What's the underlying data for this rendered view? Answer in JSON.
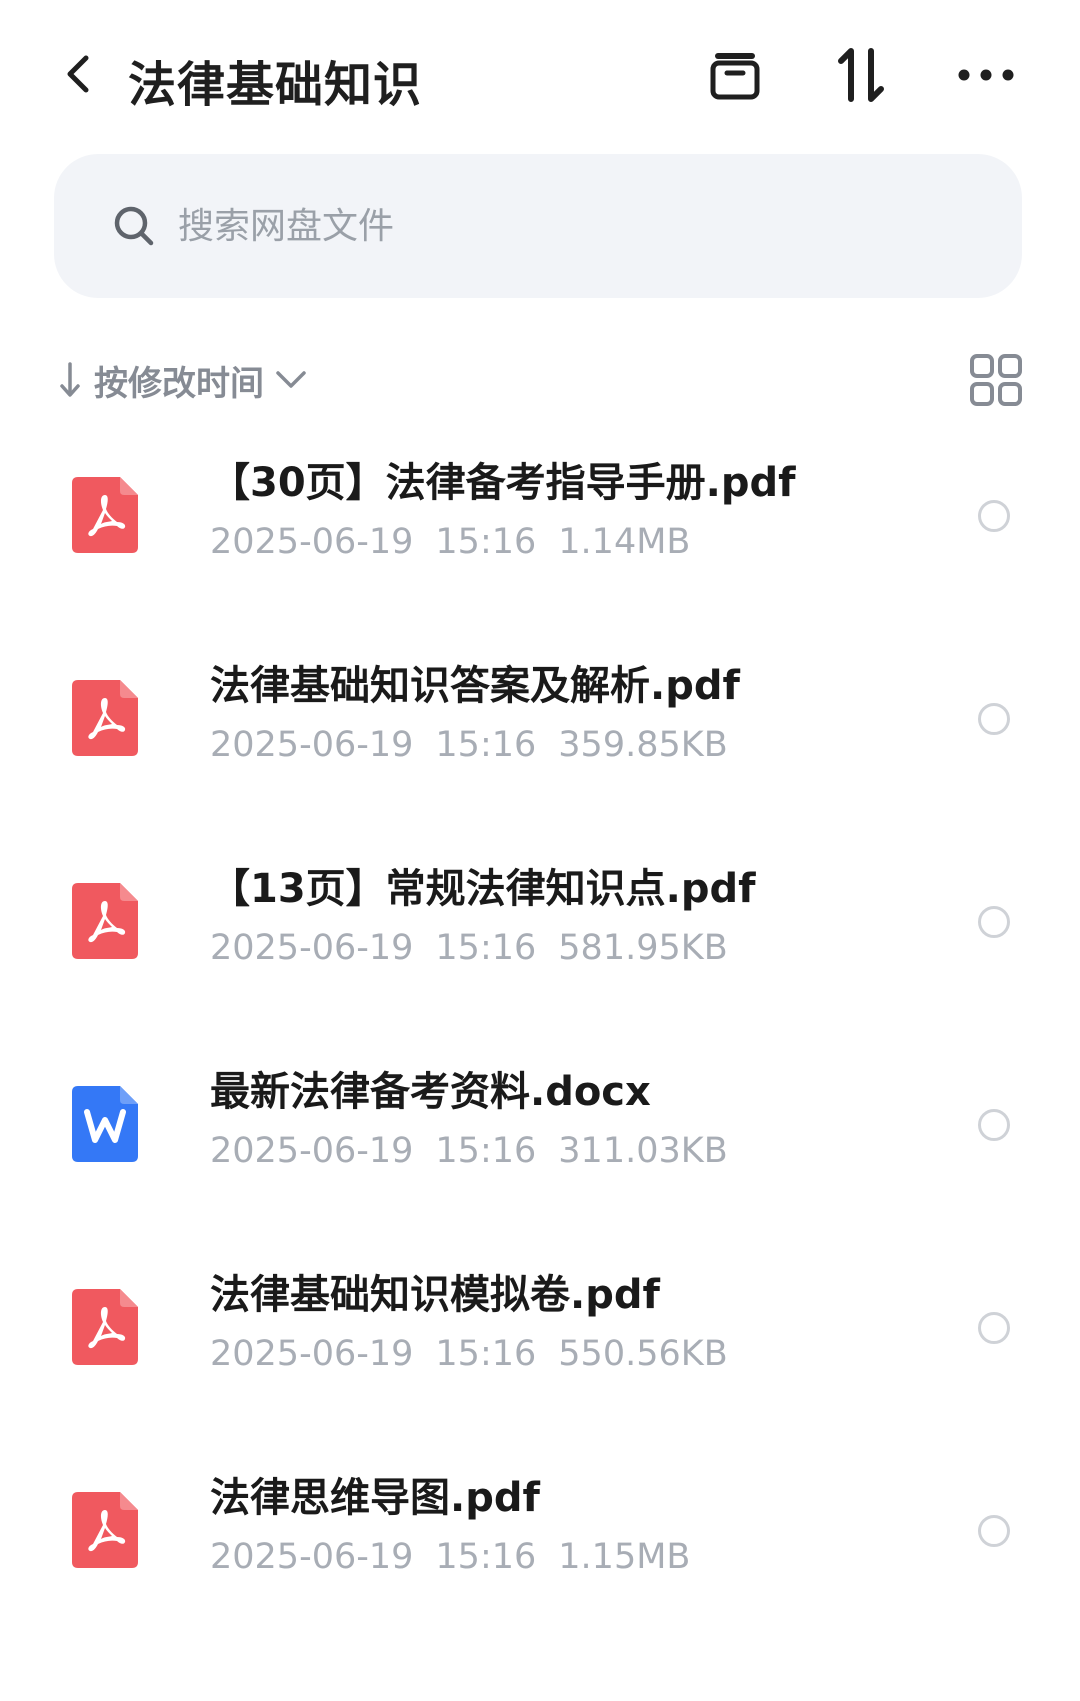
{
  "header": {
    "title": "法律基础知识",
    "icons": [
      "back-icon",
      "archive-icon",
      "sort-arrows-icon",
      "more-icon"
    ]
  },
  "search": {
    "placeholder": "搜索网盘文件"
  },
  "sort": {
    "label": "按修改时间",
    "icons": [
      "arrow-down-icon",
      "chevron-down-icon",
      "grid-view-icon"
    ]
  },
  "colors": {
    "pdf": "#f0595f",
    "word": "#3478f6",
    "meta": "#a8adb5"
  },
  "files": [
    {
      "name": "【30页】法律备考指导手册.pdf",
      "date": "2025-06-19",
      "time": "15:16",
      "size": "1.14MB",
      "type": "pdf"
    },
    {
      "name": "法律基础知识答案及解析.pdf",
      "date": "2025-06-19",
      "time": "15:16",
      "size": "359.85KB",
      "type": "pdf"
    },
    {
      "name": "【13页】常规法律知识点.pdf",
      "date": "2025-06-19",
      "time": "15:16",
      "size": "581.95KB",
      "type": "pdf"
    },
    {
      "name": "最新法律备考资料.docx",
      "date": "2025-06-19",
      "time": "15:16",
      "size": "311.03KB",
      "type": "docx"
    },
    {
      "name": "法律基础知识模拟卷.pdf",
      "date": "2025-06-19",
      "time": "15:16",
      "size": "550.56KB",
      "type": "pdf"
    },
    {
      "name": "法律思维导图.pdf",
      "date": "2025-06-19",
      "time": "15:16",
      "size": "1.15MB",
      "type": "pdf"
    }
  ]
}
